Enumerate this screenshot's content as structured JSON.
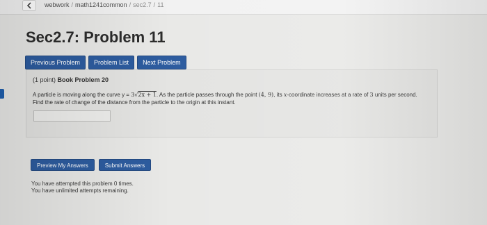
{
  "nav": {
    "back_icon": "chevron-left-icon",
    "breadcrumb": {
      "course": "webwork",
      "section": "math1241common",
      "set": "sec2.7",
      "problem": "11"
    }
  },
  "page_title": "Sec2.7: Problem 11",
  "buttons": {
    "previous": "Previous Problem",
    "list": "Problem List",
    "next": "Next Problem"
  },
  "problem": {
    "points": "(1 point)",
    "source": "Book Problem 20",
    "text_1": "A particle is moving along the curve y = ",
    "curve_coef": "3",
    "curve_radicand": "2x + 1",
    "text_2": ". As the particle passes through the point ",
    "point": "(4, 9)",
    "text_3": ", its ",
    "x_var": "x",
    "text_4": "-coordinate increases at a rate of ",
    "rate": "3",
    "text_5": " units per second. Find the rate of change of the distance from the particle to the origin at this instant.",
    "answer_value": ""
  },
  "actions": {
    "preview": "Preview My Answers",
    "submit": "Submit Answers"
  },
  "status": {
    "attempts": "You have attempted this problem 0 times.",
    "remaining": "You have unlimited attempts remaining."
  },
  "colors": {
    "button": "#2d5c9f",
    "panel": "#e4e4e2",
    "marker": "#1f5fae"
  }
}
